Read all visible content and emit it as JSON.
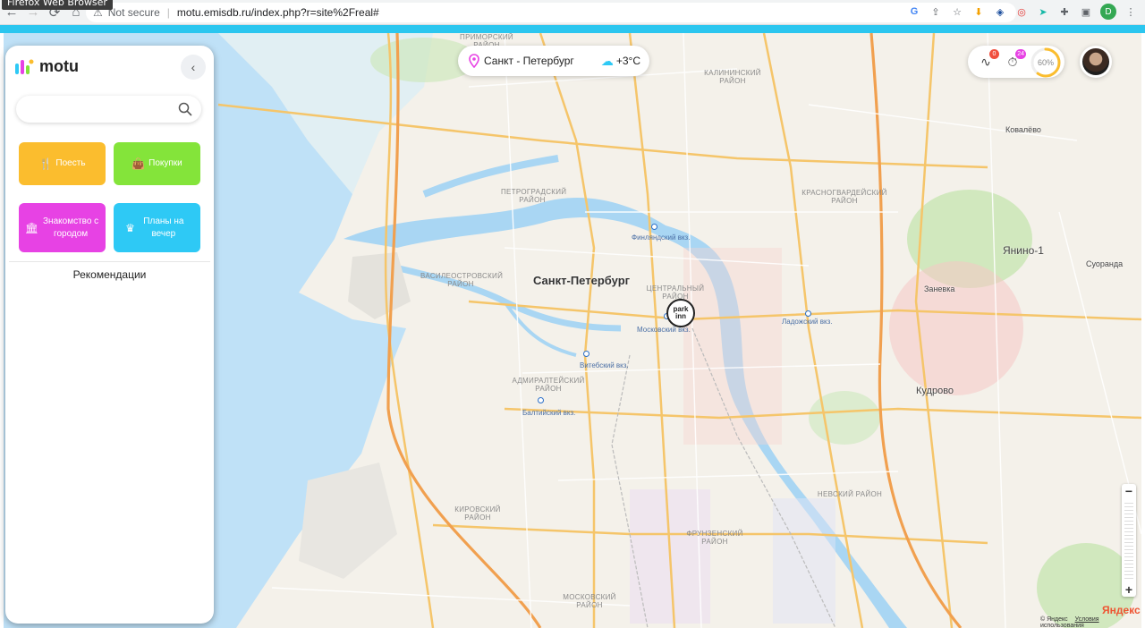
{
  "browser": {
    "tooltip": "Firefox Web Browser",
    "security": "Not secure",
    "url": "motu.emisdb.ru/index.php?r=site%2Freal#",
    "profile_initial": "D"
  },
  "sidebar": {
    "logo_text": "motu",
    "search_placeholder": "",
    "categories": [
      {
        "label": "Поесть",
        "color": "#fbbd2e"
      },
      {
        "label": "Покупки",
        "color": "#84e43a"
      },
      {
        "label": "Знакомство с городом",
        "color": "#e742e4"
      },
      {
        "label": "Планы на вечер",
        "color": "#2ec9f5"
      }
    ],
    "recommendations_label": "Рекомендации"
  },
  "top": {
    "city": "Санкт - Петербург",
    "temperature": "+3°C",
    "badge_routes": "0",
    "badge_timer": "24",
    "progress": "60%",
    "progress_value": 0.6
  },
  "map": {
    "city_name": "Санкт-Петербург",
    "districts": [
      "ПЕТРОГРАДСКИЙ РАЙОН",
      "ВАСИЛЕОСТРОВСКИЙ РАЙОН",
      "ЦЕНТРАЛЬНЫЙ РАЙОН",
      "АДМИРАЛТЕЙСКИЙ РАЙОН",
      "КИРОВСКИЙ РАЙОН",
      "ФРУНЗЕНСКИЙ РАЙОН",
      "МОСКОВСКИЙ РАЙОН",
      "НЕВСКИЙ РАЙОН",
      "КРАСНОГВАРДЕЙСКИЙ РАЙОН",
      "КАЛИНИНСКИЙ РАЙОН",
      "ПРИМОРСКИЙ РАЙОН"
    ],
    "suburbs": [
      "Янино-1",
      "Заневка",
      "Кудрово",
      "Суоранда",
      "Ковалёво"
    ],
    "stations": [
      "Финляндский вкз.",
      "Московский вкз.",
      "Ладожский вкз.",
      "Витебский вкз.",
      "Балтийский вкз."
    ],
    "hotel_marker": "park inn",
    "attribution": "© Яндекс",
    "terms": "Условия использования",
    "brand": "Яндекс",
    "zoom_in": "+",
    "zoom_out": "−"
  }
}
